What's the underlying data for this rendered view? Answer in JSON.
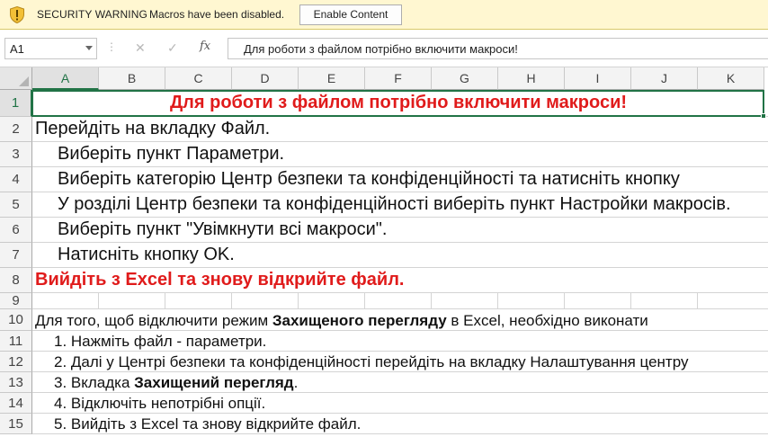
{
  "security_bar": {
    "title": "SECURITY WARNING",
    "message": "Macros have been disabled.",
    "button_label": "Enable Content"
  },
  "formula_bar": {
    "name_box": "A1",
    "formula": "Для роботи з файлом потрібно включити макроси!"
  },
  "grid": {
    "columns": [
      "A",
      "B",
      "C",
      "D",
      "E",
      "F",
      "G",
      "H",
      "I",
      "J",
      "K"
    ],
    "rows": [
      "1",
      "2",
      "3",
      "4",
      "5",
      "6",
      "7",
      "8",
      "9",
      "10",
      "11",
      "12",
      "13",
      "14",
      "15"
    ],
    "selected_cell": "A1"
  },
  "cells": {
    "r1": "Для роботи з файлом потрібно включити макроси!",
    "r2": "Перейдіть на вкладку Файл.",
    "r3": "Виберіть пункт Параметри.",
    "r4": "Виберіть категорію Центр безпеки та конфіденційності та натисніть кнопку",
    "r5": "У розділі Центр безпеки та конфіденційності виберіть пункт Настройки макросів.",
    "r6": "Виберіть пункт \"Увімкнути всі макроси\".",
    "r7": "Натисніть кнопку OK.",
    "r8": "Вийдіть з Excel та знову відкрийте файл.",
    "r10_a": "Для того, щоб відключити режим ",
    "r10_b": "Захищеного перегляду",
    "r10_c": " в Excel, необхідно виконати",
    "r11": "1. Нажміть файл - параметри.",
    "r12": "2. Далі у Центрі безпеки та конфіденційності перейдіть на вкладку Налаштування центру",
    "r13_a": "3. Вкладка ",
    "r13_b": "Захищений перегляд",
    "r13_c": ".",
    "r14": "4. Відключіть непотрібні опції.",
    "r15": "5. Вийдіть з Excel та знову відкрийте файл."
  },
  "colors": {
    "accent": "#217346",
    "warning_text": "#e01b1b",
    "message_bar": "#fff7d1"
  }
}
